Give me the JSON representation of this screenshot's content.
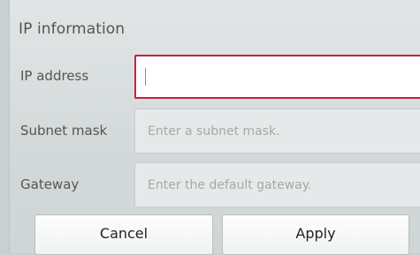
{
  "dialog": {
    "title": "IP information"
  },
  "fields": {
    "ip_address": {
      "label": "IP address",
      "value": "",
      "placeholder": ""
    },
    "subnet_mask": {
      "label": "Subnet mask",
      "placeholder": "Enter a subnet mask."
    },
    "gateway": {
      "label": "Gateway",
      "placeholder": "Enter the default gateway."
    }
  },
  "buttons": {
    "cancel": "Cancel",
    "apply": "Apply"
  },
  "colors": {
    "focus_border": "#c8203e",
    "panel_background": "#d3d9d9"
  }
}
